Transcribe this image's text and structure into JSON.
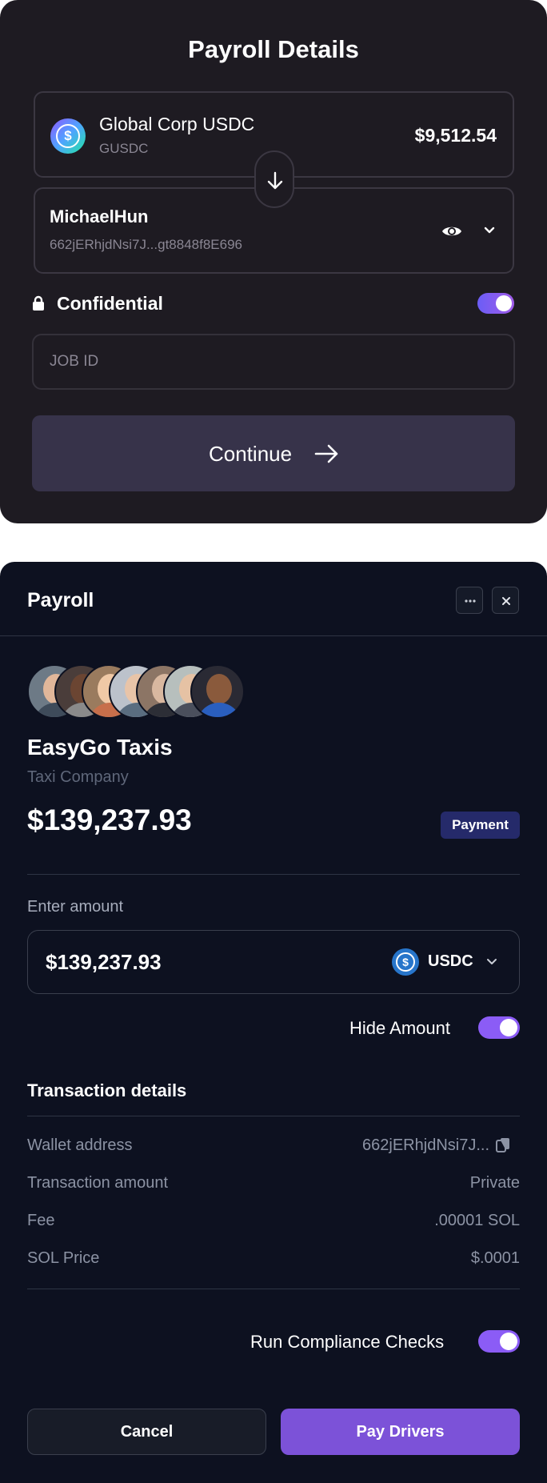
{
  "payroll_details": {
    "title": "Payroll Details",
    "from": {
      "name": "Global Corp USDC",
      "symbol": "GUSDC",
      "balance": "$9,512.54",
      "icon": "usdc-gradient-logo"
    },
    "swap_icon": "arrow-down-icon",
    "to": {
      "name": "MichaelHun",
      "address": "662jERhjdNsi7J...gt8848f8E696",
      "icons": [
        "eye-icon",
        "chevron-down-icon"
      ]
    },
    "confidential": {
      "label": "Confidential",
      "enabled": true,
      "icon": "lock-icon"
    },
    "job_id": {
      "placeholder": "JOB ID",
      "value": ""
    },
    "continue_label": "Continue"
  },
  "payroll": {
    "title": "Payroll",
    "header_icons": [
      "more-icon",
      "close-icon"
    ],
    "company": {
      "name": "EasyGo Taxis",
      "type": "Taxi Company",
      "amount": "$139,237.93",
      "badge": "Payment",
      "avatar_count": 7
    },
    "enter_amount": {
      "label": "Enter amount",
      "value": "$139,237.93",
      "currency": "USDC"
    },
    "hide_amount": {
      "label": "Hide Amount",
      "enabled": true
    },
    "transaction": {
      "title": "Transaction details",
      "rows": [
        {
          "label": "Wallet address",
          "value": "662jERhjdNsi7J..."
        },
        {
          "label": "Transaction amount",
          "value": "Private"
        },
        {
          "label": "Fee",
          "value": ".00001 SOL"
        },
        {
          "label": "SOL Price",
          "value": "$.0001"
        }
      ]
    },
    "compliance": {
      "label": "Run Compliance Checks",
      "enabled": true
    },
    "cancel_label": "Cancel",
    "pay_label": "Pay Drivers"
  },
  "colors": {
    "card1_bg": "#1e1b22",
    "card2_bg": "#0d1120",
    "accent_purple": "#7c52d8",
    "badge_bg": "#252a6a"
  }
}
